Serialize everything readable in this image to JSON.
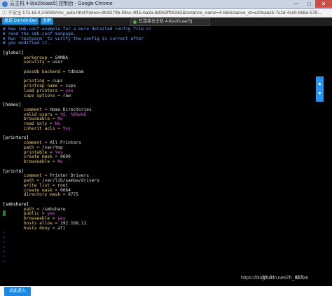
{
  "window": {
    "title": "云主机 4-8(e20caac5) 控制台 - Google Chrome",
    "min": "─",
    "max": "□",
    "close": "✕"
  },
  "address": {
    "insecure": "ⓘ 不安全",
    "url": "172.16.0.2:6080/vnc_auto.html?token=3fc8279b-59cc-4f15-ba3a-8d062ff09262&instance_name=4-8&instance_id=e20caac5-7c2d-4cc0-b68a-579..."
  },
  "toolbar": {
    "cad_label": "发送 Ctrl+Alt+Del",
    "full_label": "全屏",
    "status": "已连接云主机 4-8(e20caac5)"
  },
  "terminal": {
    "lines": [
      [
        {
          "t": "# See smb.conf.example for a more detailed config file or",
          "c": "c-comment"
        }
      ],
      [
        {
          "t": "# read the smb.conf manpage.",
          "c": "c-comment"
        }
      ],
      [
        {
          "t": "# Run 'testparm' to verify the config is correct after",
          "c": "c-comment"
        }
      ],
      [
        {
          "t": "# you modified it.",
          "c": "c-comment"
        }
      ],
      [
        {
          "t": "",
          "c": "c-val"
        }
      ],
      [
        {
          "t": "[global]",
          "c": "c-section"
        }
      ],
      [
        {
          "t": "        workgroup",
          "c": "c-key"
        },
        {
          "t": " = ",
          "c": "c-eq"
        },
        {
          "t": "SAMBA",
          "c": "c-val"
        }
      ],
      [
        {
          "t": "        security",
          "c": "c-key"
        },
        {
          "t": " = ",
          "c": "c-eq"
        },
        {
          "t": "user",
          "c": "c-val"
        }
      ],
      [
        {
          "t": "",
          "c": "c-val"
        }
      ],
      [
        {
          "t": "        passdb backend",
          "c": "c-key"
        },
        {
          "t": " = ",
          "c": "c-eq"
        },
        {
          "t": "tdbsam",
          "c": "c-val"
        }
      ],
      [
        {
          "t": "",
          "c": "c-val"
        }
      ],
      [
        {
          "t": "        printing",
          "c": "c-key"
        },
        {
          "t": " = ",
          "c": "c-eq"
        },
        {
          "t": "cups",
          "c": "c-val"
        }
      ],
      [
        {
          "t": "        printcap name",
          "c": "c-key"
        },
        {
          "t": " = ",
          "c": "c-eq"
        },
        {
          "t": "cups",
          "c": "c-val"
        }
      ],
      [
        {
          "t": "        load printers",
          "c": "c-key"
        },
        {
          "t": " = ",
          "c": "c-eq"
        },
        {
          "t": "yes",
          "c": "c-bool"
        }
      ],
      [
        {
          "t": "        cups options",
          "c": "c-key"
        },
        {
          "t": " = ",
          "c": "c-eq"
        },
        {
          "t": "raw",
          "c": "c-val"
        }
      ],
      [
        {
          "t": "",
          "c": "c-val"
        }
      ],
      [
        {
          "t": "[homes]",
          "c": "c-section"
        }
      ],
      [
        {
          "t": "        comment",
          "c": "c-key"
        },
        {
          "t": " = ",
          "c": "c-eq"
        },
        {
          "t": "Home Directories",
          "c": "c-val"
        }
      ],
      [
        {
          "t": "        valid users",
          "c": "c-key"
        },
        {
          "t": " = ",
          "c": "c-eq"
        },
        {
          "t": "%S, %D%w%S",
          "c": "c-bool"
        }
      ],
      [
        {
          "t": "        browseable",
          "c": "c-key"
        },
        {
          "t": " = ",
          "c": "c-eq"
        },
        {
          "t": "No",
          "c": "c-bool"
        }
      ],
      [
        {
          "t": "        read only",
          "c": "c-key"
        },
        {
          "t": " = ",
          "c": "c-eq"
        },
        {
          "t": "No",
          "c": "c-bool"
        }
      ],
      [
        {
          "t": "        inherit acls",
          "c": "c-key"
        },
        {
          "t": " = ",
          "c": "c-eq"
        },
        {
          "t": "Yes",
          "c": "c-bool"
        }
      ],
      [
        {
          "t": "",
          "c": "c-val"
        }
      ],
      [
        {
          "t": "[printers]",
          "c": "c-section"
        }
      ],
      [
        {
          "t": "        comment",
          "c": "c-key"
        },
        {
          "t": " = ",
          "c": "c-eq"
        },
        {
          "t": "All Printers",
          "c": "c-val"
        }
      ],
      [
        {
          "t": "        path",
          "c": "c-key"
        },
        {
          "t": " = ",
          "c": "c-eq"
        },
        {
          "t": "/var/tmp",
          "c": "c-val"
        }
      ],
      [
        {
          "t": "        printable",
          "c": "c-key"
        },
        {
          "t": " = ",
          "c": "c-eq"
        },
        {
          "t": "Yes",
          "c": "c-bool"
        }
      ],
      [
        {
          "t": "        create mask",
          "c": "c-key"
        },
        {
          "t": " = ",
          "c": "c-eq"
        },
        {
          "t": "0600",
          "c": "c-val"
        }
      ],
      [
        {
          "t": "        browseable",
          "c": "c-key"
        },
        {
          "t": " = ",
          "c": "c-eq"
        },
        {
          "t": "No",
          "c": "c-bool"
        }
      ],
      [
        {
          "t": "",
          "c": "c-val"
        }
      ],
      [
        {
          "t": "[print$]",
          "c": "c-section"
        }
      ],
      [
        {
          "t": "        comment",
          "c": "c-key"
        },
        {
          "t": " = ",
          "c": "c-eq"
        },
        {
          "t": "Printer Drivers",
          "c": "c-val"
        }
      ],
      [
        {
          "t": "        path",
          "c": "c-key"
        },
        {
          "t": " = ",
          "c": "c-eq"
        },
        {
          "t": "/var/lib/samba/drivers",
          "c": "c-val"
        }
      ],
      [
        {
          "t": "        write list",
          "c": "c-key"
        },
        {
          "t": " = ",
          "c": "c-eq"
        },
        {
          "t": "root",
          "c": "c-val"
        }
      ],
      [
        {
          "t": "        create mask",
          "c": "c-key"
        },
        {
          "t": " = ",
          "c": "c-eq"
        },
        {
          "t": "0664",
          "c": "c-val"
        }
      ],
      [
        {
          "t": "        directory mask",
          "c": "c-key"
        },
        {
          "t": " = ",
          "c": "c-eq"
        },
        {
          "t": "0775",
          "c": "c-val"
        }
      ],
      [
        {
          "t": "",
          "c": "c-val"
        }
      ],
      [
        {
          "t": "[smbshare]",
          "c": "c-section"
        }
      ],
      [
        {
          "t": "        path",
          "c": "c-key"
        },
        {
          "t": " = ",
          "c": "c-eq"
        },
        {
          "t": "/smbshare",
          "c": "c-val"
        }
      ],
      [
        {
          "t": "█",
          "c": "c-cursor"
        },
        {
          "t": "       public",
          "c": "c-key"
        },
        {
          "t": " = ",
          "c": "c-eq"
        },
        {
          "t": "yes",
          "c": "c-bool"
        }
      ],
      [
        {
          "t": "        browseable",
          "c": "c-key"
        },
        {
          "t": " = ",
          "c": "c-eq"
        },
        {
          "t": "yes",
          "c": "c-bool"
        }
      ],
      [
        {
          "t": "        hosts allow",
          "c": "c-key"
        },
        {
          "t": " = ",
          "c": "c-eq"
        },
        {
          "t": "192.168.12.",
          "c": "c-val"
        }
      ],
      [
        {
          "t": "        hosts deny",
          "c": "c-key"
        },
        {
          "t": " = ",
          "c": "c-eq"
        },
        {
          "t": "all",
          "c": "c-val"
        }
      ]
    ],
    "tildes": 7,
    "tilde_char": "~",
    "position": "39,1",
    "scroll": "All"
  },
  "side_tabs": {
    "up": "▲",
    "down": "▼"
  },
  "click_enter_label": "点此进入",
  "watermark": "https://blog.csdn.net/Zh_SaTan",
  "colors": {
    "comment": "#66a3ff",
    "key": "#e8c86a",
    "bool": "#e35be0",
    "accent": "#1e88e5"
  }
}
